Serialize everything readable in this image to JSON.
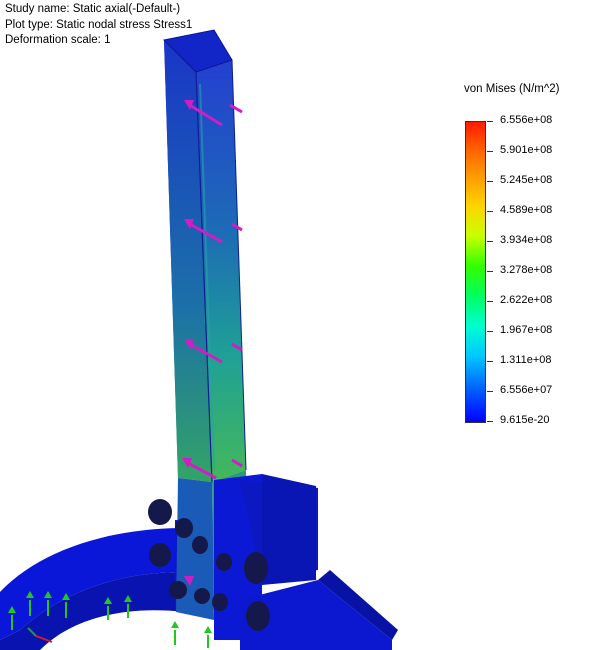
{
  "study": {
    "name_line": "Study name: Static axial(-Default-)",
    "plot_type_line": "Plot type: Static nodal stress Stress1",
    "deformation_line": "Deformation scale: 1"
  },
  "legend": {
    "title": "von Mises (N/m^2)",
    "values": [
      "6.556e+08",
      "5.901e+08",
      "5.245e+08",
      "4.589e+08",
      "3.934e+08",
      "3.278e+08",
      "2.622e+08",
      "1.967e+08",
      "1.311e+08",
      "6.556e+07",
      "9.615e-20"
    ],
    "max_color": "#ff1a00",
    "min_color": "#0000ff"
  },
  "colors": {
    "model_base": "#0a17d8",
    "load_arrow": "#d21cc4",
    "fixture_arrow": "#22c81f"
  }
}
